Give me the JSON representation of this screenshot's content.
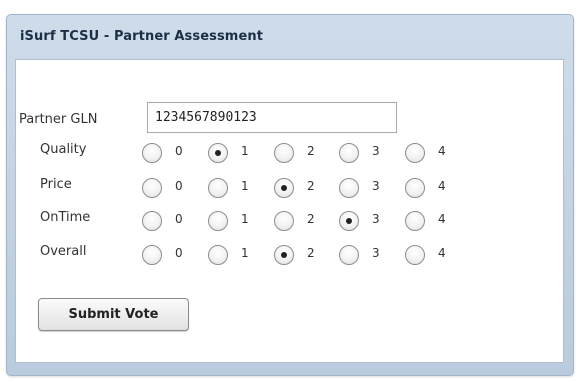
{
  "panel": {
    "title": "iSurf TCSU - Partner Assessment"
  },
  "form": {
    "gln_label": "Partner GLN",
    "gln_value": "1234567890123",
    "options": [
      "0",
      "1",
      "2",
      "3",
      "4"
    ],
    "ratings": [
      {
        "label": "Quality",
        "selected": "1"
      },
      {
        "label": "Price",
        "selected": "2"
      },
      {
        "label": "OnTime",
        "selected": "3"
      },
      {
        "label": "Overall",
        "selected": "2"
      }
    ],
    "submit_label": "Submit Vote"
  }
}
